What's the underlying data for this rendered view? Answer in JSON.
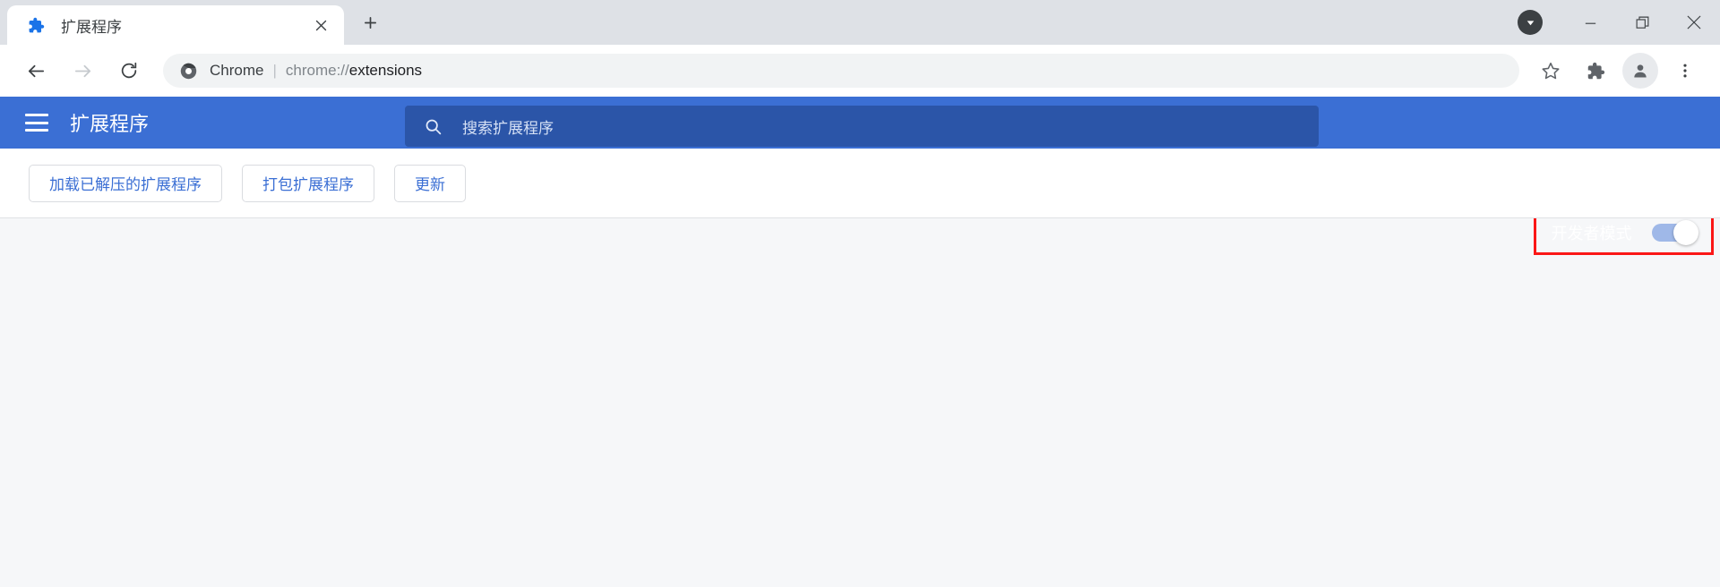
{
  "browser": {
    "tab": {
      "title": "扩展程序",
      "favicon_icon": "puzzle-piece-icon",
      "close_icon": "close-icon"
    },
    "new_tab_icon": "plus-icon",
    "window_controls": {
      "download_icon": "download-arrow-icon",
      "minimize_icon": "minimize-icon",
      "maximize_icon": "maximize-restore-icon",
      "close_icon": "close-icon"
    },
    "toolbar": {
      "back_icon": "back-arrow-icon",
      "forward_icon": "forward-arrow-icon",
      "reload_icon": "reload-icon",
      "omnibox": {
        "site_icon": "chrome-logo-icon",
        "site_label": "Chrome",
        "separator": "|",
        "url_scheme": "chrome://",
        "url_host": "extensions"
      },
      "bookmark_icon": "star-icon",
      "extensions_icon": "puzzle-piece-icon",
      "profile_icon": "person-avatar-icon",
      "menu_icon": "three-dot-menu-icon"
    }
  },
  "page": {
    "header": {
      "menu_icon": "hamburger-menu-icon",
      "title": "扩展程序",
      "search": {
        "icon": "search-icon",
        "placeholder": "搜索扩展程序",
        "value": ""
      },
      "developer_mode": {
        "label": "开发者模式",
        "enabled": true,
        "highlight_color": "#fb1717"
      }
    },
    "actions": [
      {
        "label": "加载已解压的扩展程序"
      },
      {
        "label": "打包扩展程序"
      },
      {
        "label": "更新"
      }
    ],
    "extension_list": []
  },
  "colors": {
    "header_blue": "#3b6fd4",
    "search_blue": "#2b55a8",
    "tabstrip_gray": "#dee1e6",
    "content_gray": "#f6f7f9",
    "action_text_blue": "#3b6fd4"
  }
}
